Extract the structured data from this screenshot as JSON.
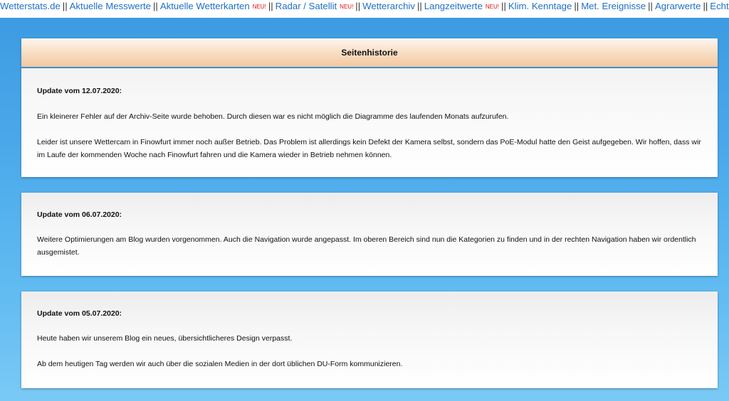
{
  "nav": {
    "items": [
      {
        "label": "Wetterstats.de",
        "neu": false
      },
      {
        "label": "Aktuelle Messwerte",
        "neu": false
      },
      {
        "label": "Aktuelle Wetterkarten",
        "neu": true
      },
      {
        "label": "Radar / Satellit",
        "neu": true
      },
      {
        "label": "Wetterarchiv",
        "neu": false
      },
      {
        "label": "Langzeitwerte",
        "neu": true
      },
      {
        "label": "Klim. Kenntage",
        "neu": false
      },
      {
        "label": "Met. Ereignisse",
        "neu": false
      },
      {
        "label": "Agrarwerte",
        "neu": false
      },
      {
        "label": "Echtzeit",
        "neu": false
      }
    ],
    "separator": "||",
    "neu_badge": "NEU!",
    "link_color": "#1f6fc9",
    "badge_color": "#e01010"
  },
  "history": {
    "title": "Seitenhistorie",
    "updates": [
      {
        "title": "Update vom 12.07.2020:",
        "paragraphs": [
          "Ein kleinerer Fehler auf der Archiv-Seite wurde behoben. Durch diesen war es nicht möglich die Diagramme des laufenden Monats aufzurufen.",
          "Leider ist unsere Wettercam in Finowfurt immer noch außer Betrieb. Das Problem ist allerdings kein Defekt der Kamera selbst, sondern das PoE-Modul hatte den Geist aufgegeben. Wir hoffen, dass wir im Laufe der kommenden Woche nach Finowfurt fahren und die Kamera wieder in Betrieb nehmen können."
        ]
      },
      {
        "title": "Update vom 06.07.2020:",
        "paragraphs": [
          "Weitere Optimierungen am Blog wurden vorgenommen. Auch die Navigation wurde angepasst. Im oberen Bereich sind nun die Kategorien zu finden und in der rechten Navigation haben wir ordentlich ausgemistet."
        ]
      },
      {
        "title": "Update vom 05.07.2020:",
        "paragraphs": [
          "Heute haben wir unserem Blog ein neues, übersichtlicheres Design verpasst.",
          "Ab dem heutigen Tag werden wir auch über die sozialen Medien in der dort üblichen DU-Form kommunizieren."
        ]
      }
    ]
  }
}
